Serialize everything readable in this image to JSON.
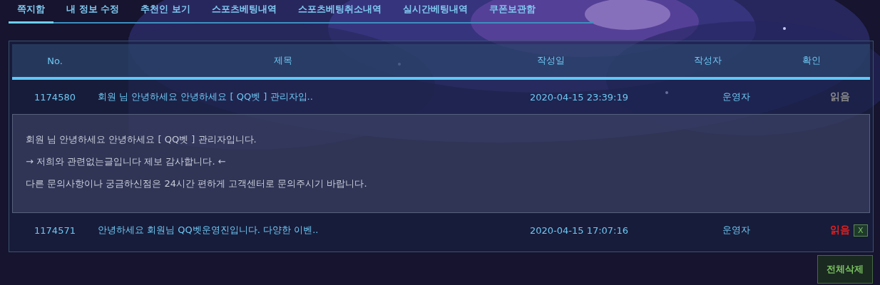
{
  "tabs": [
    {
      "label": "쪽지함",
      "selected": true
    },
    {
      "label": "내 정보 수정",
      "selected": false
    },
    {
      "label": "추천인 보기",
      "selected": false
    },
    {
      "label": "스포츠베팅내역",
      "selected": false
    },
    {
      "label": "스포츠베팅취소내역",
      "selected": false
    },
    {
      "label": "실시간베팅내역",
      "selected": false
    },
    {
      "label": "쿠폰보관함",
      "selected": false
    }
  ],
  "table": {
    "columns": [
      "No.",
      "제목",
      "작성일",
      "작성자",
      "확인"
    ],
    "rows": [
      {
        "no": "1174580",
        "title": "회원 님 안녕하세요 안녕하세요 [ QQ벳 ] 관리자입..",
        "date": "2020-04-15 23:39:19",
        "author": "운영자",
        "status": "읽음",
        "color": "#8a8a8a",
        "expanded": true,
        "body": [
          "회원 님 안녕하세요 안녕하세요 [ QQ벳 ] 관리자입니다.",
          "→ 저희와 관련없는글입니다 제보 감사합니다. ←",
          "다른 문의사항이나 궁금하신점은 24시간 편하게 고객센터로 문의주시기 바랍니다."
        ]
      },
      {
        "no": "1174571",
        "title": "안녕하세요 회원님 QQ벳운영진입니다. 다양한 이벤..",
        "date": "2020-04-15 17:07:16",
        "author": "운영자",
        "status": "읽음",
        "color": "#e02020",
        "expanded": false,
        "delete_button": "X"
      }
    ]
  },
  "delete_all_button": "전체삭제"
}
